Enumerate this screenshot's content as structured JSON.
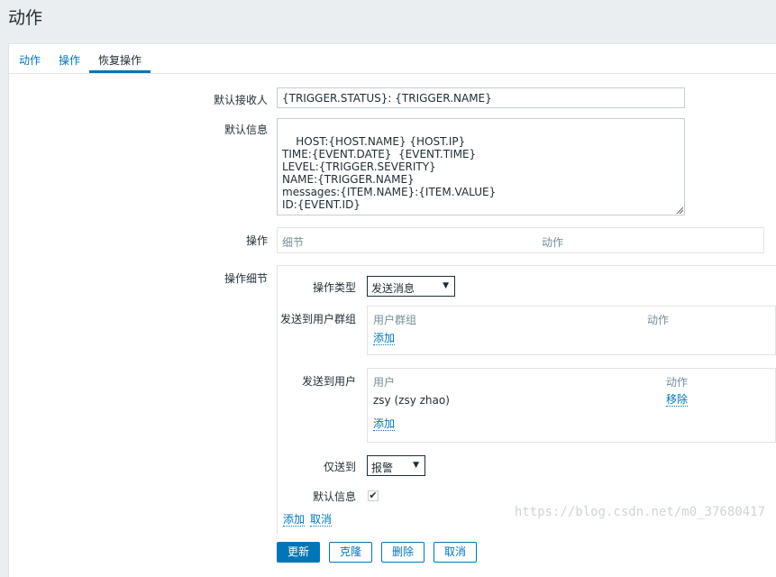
{
  "page": {
    "title": "动作"
  },
  "tabs": [
    {
      "label": "动作"
    },
    {
      "label": "操作"
    },
    {
      "label": "恢复操作"
    }
  ],
  "form": {
    "default_subject_label": "默认接收人",
    "default_subject_value": "{TRIGGER.STATUS}: {TRIGGER.NAME}",
    "default_message_label": "默认信息",
    "default_message_value": "HOST:{HOST.NAME} {HOST.IP}\nTIME:{EVENT.DATE}  {EVENT.TIME}\nLEVEL:{TRIGGER.SEVERITY}\nNAME:{TRIGGER.NAME}\nmessages:{ITEM.NAME}:{ITEM.VALUE}\nID:{EVENT.ID}",
    "operations_label": "操作",
    "operations_table": {
      "col_details": "细节",
      "col_action": "动作"
    },
    "operation_details_label": "操作细节",
    "operation_type_label": "操作类型",
    "operation_type_value": "发送消息",
    "send_to_groups_label": "发送到用户群组",
    "groups_table": {
      "col_group": "用户群组",
      "col_action": "动作",
      "add": "添加"
    },
    "send_to_users_label": "发送到用户",
    "users_table": {
      "col_user": "用户",
      "col_action": "动作",
      "rows": [
        {
          "user": "zsy (zsy zhao)",
          "action": "移除"
        }
      ],
      "add": "添加"
    },
    "send_only_to_label": "仅送到",
    "send_only_to_value": "报警",
    "default_message_check_label": "默认信息",
    "default_message_checked": true,
    "op_add": "添加",
    "op_cancel": "取消"
  },
  "buttons": {
    "update": "更新",
    "clone": "克隆",
    "delete": "删除",
    "cancel": "取消"
  },
  "watermark": "https://blog.csdn.net/m0_37680417"
}
